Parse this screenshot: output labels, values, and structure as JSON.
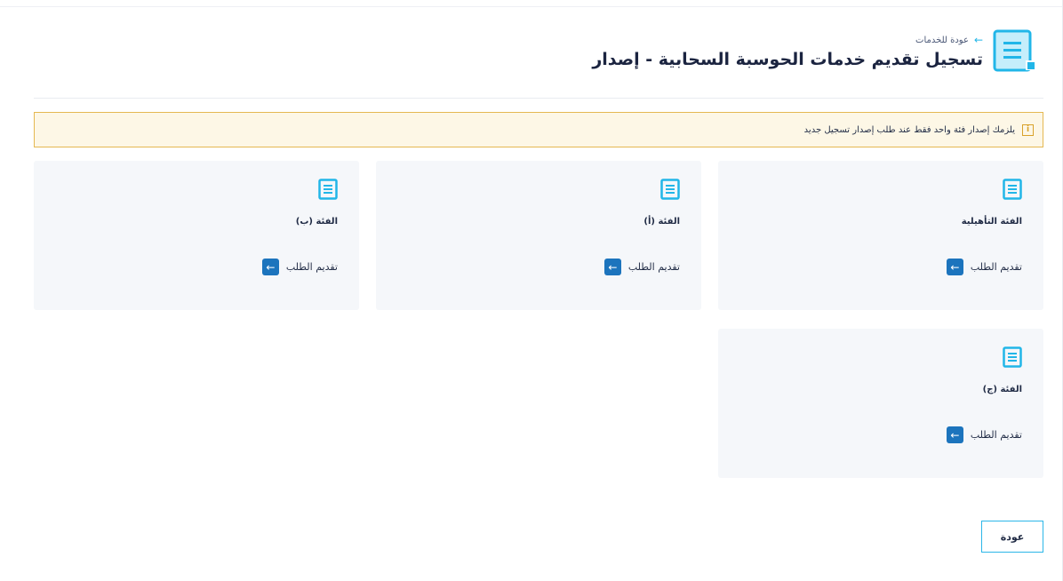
{
  "header": {
    "back_link": "عودة للخدمات",
    "title": "تسجيل تقديم خدمات الحوسبة السحابية - إصدار",
    "icon": "document-icon"
  },
  "alert": {
    "icon": "info-icon",
    "icon_glyph": "i",
    "text": "يلزمك إصدار فئة واحد فقط عند طلب إصدار تسجيل جديد"
  },
  "cards": [
    {
      "title": "الفئة التأهيلية",
      "action": "تقديم الطلب"
    },
    {
      "title": "الفئة (أ)",
      "action": "تقديم الطلب"
    },
    {
      "title": "الفئة (ب)",
      "action": "تقديم الطلب"
    },
    {
      "title": "الفئة (ج)",
      "action": "تقديم الطلب"
    }
  ],
  "footer": {
    "back_button": "عودة"
  },
  "colors": {
    "accent": "#21b6e8",
    "button": "#1c74bd",
    "alert_bg": "#fdf7e6",
    "alert_border": "#e5b852",
    "card_bg": "#f5f7fa"
  }
}
